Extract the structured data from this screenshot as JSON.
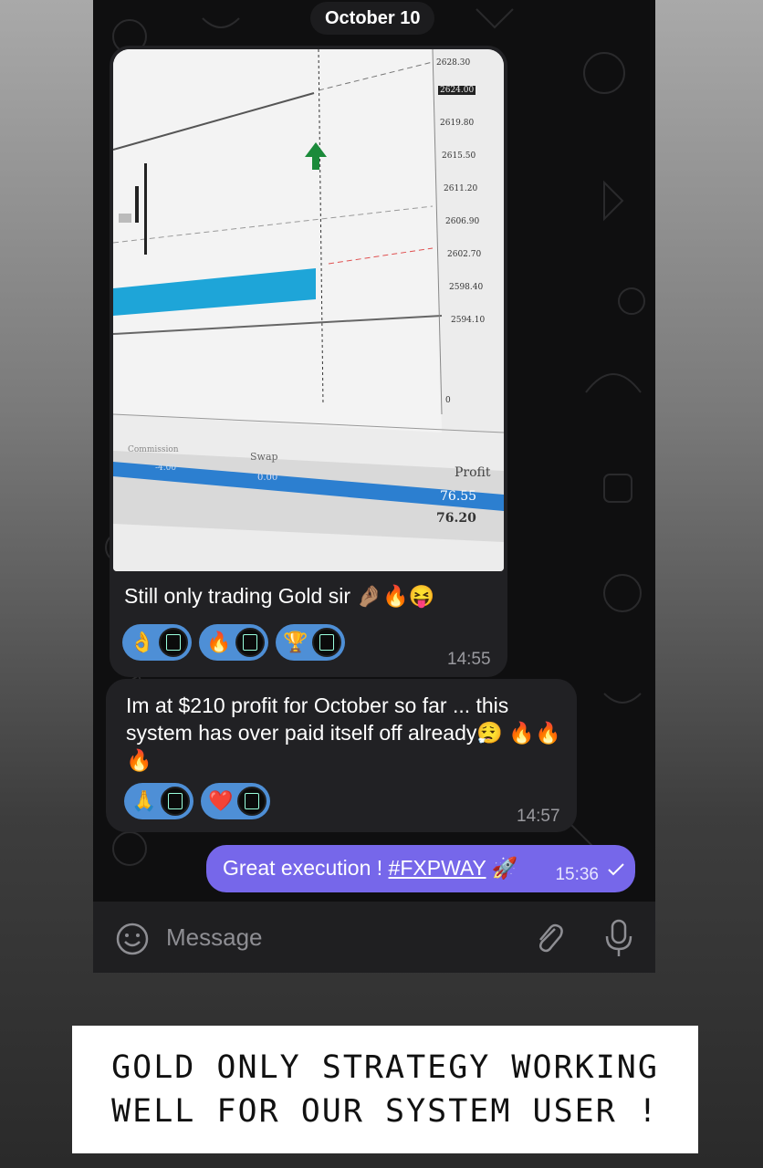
{
  "date_label": "October 10",
  "message1": {
    "photo": {
      "price_ticks": [
        "2628.30",
        "2624.00",
        "2619.80",
        "2615.50",
        "2611.20",
        "2606.90",
        "2602.70",
        "2598.40",
        "2594.10",
        "0",
        "0"
      ],
      "table_headers": {
        "commission": "Commission",
        "swap": "Swap",
        "profit": "Profit"
      },
      "row_values": {
        "commission": "-4.00",
        "swap": "0.00",
        "profit": "76.55"
      },
      "total_profit": "76.20",
      "arrow": "arrow-up-icon"
    },
    "text": "Still only trading Gold sir 🤌🏽🔥😝",
    "reactions": [
      {
        "emoji": "👌",
        "name": "ok-hand-icon"
      },
      {
        "emoji": "🔥",
        "name": "fire-icon"
      },
      {
        "emoji": "🏆",
        "name": "trophy-icon"
      }
    ],
    "time": "14:55"
  },
  "message2": {
    "text": "Im at $210 profit for October so far ... this system has over paid itself off already😮‍💨 🔥🔥🔥",
    "reactions": [
      {
        "emoji": "🙏",
        "name": "pray-icon"
      },
      {
        "emoji": "❤️",
        "name": "heart-icon"
      }
    ],
    "time": "14:57"
  },
  "message3": {
    "text_prefix": "Great execution ! ",
    "hashtag": "#FXPWAY",
    "rocket": "🚀",
    "time": "15:36",
    "status": "sent-check-icon"
  },
  "composer": {
    "placeholder": "Message"
  },
  "overlay_caption": {
    "line1": "GOLD ONLY STRATEGY WORKING",
    "line2": "WELL FOR OUR SYSTEM USER !"
  },
  "colors": {
    "outgoing_bubble": "#7667ea",
    "incoming_bubble": "#212124",
    "reaction_pill": "#4e8fd6",
    "chart_bar": "#1ea5d8"
  }
}
